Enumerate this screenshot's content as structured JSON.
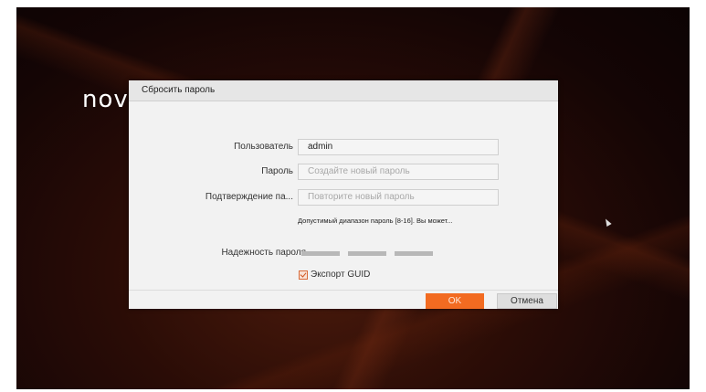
{
  "brand": {
    "logo_text": "novic"
  },
  "dialog": {
    "title": "Сбросить пароль",
    "fields": [
      {
        "label": "Пользователь",
        "value": "admin",
        "placeholder": ""
      },
      {
        "label": "Пароль",
        "value": "",
        "placeholder": "Создайте новый пароль"
      },
      {
        "label": "Подтверждение па...",
        "value": "",
        "placeholder": "Повторите новый пароль"
      }
    ],
    "hint": "Допустимый диапазон пароль [8-16]. Вы может...",
    "strength": {
      "label": "Надежность пароля",
      "level": 0,
      "segments": 3
    },
    "export_guid": {
      "label": "Экспорт GUID",
      "checked": true
    },
    "buttons": {
      "ok": "OK",
      "cancel": "Отмена"
    }
  },
  "colors": {
    "accent": "#f26b21",
    "dialog_bg": "#f2f2f2"
  },
  "icons": [
    "checkbox-checked-icon",
    "mouse-cursor-icon"
  ]
}
